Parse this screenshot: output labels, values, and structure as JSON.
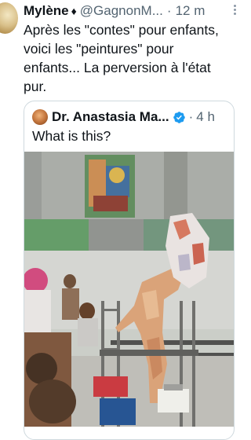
{
  "tweet": {
    "author_name": "Mylène",
    "author_badge": "♦︎",
    "handle": "@GagnonM...",
    "separator": "·",
    "time": "12 m",
    "text": "Après les \"contes\" pour enfants,\nvoici les \"peintures\" pour\nenfants... La perversion à l'état\npur."
  },
  "quoted": {
    "author_name": "Dr. Anastasia Ma...",
    "separator": "·",
    "time": "4 h",
    "text": "What is this?",
    "verified_color": "#1d9bf0"
  },
  "icons": {
    "more": "more-dots-icon",
    "verified": "verified-badge-icon"
  }
}
